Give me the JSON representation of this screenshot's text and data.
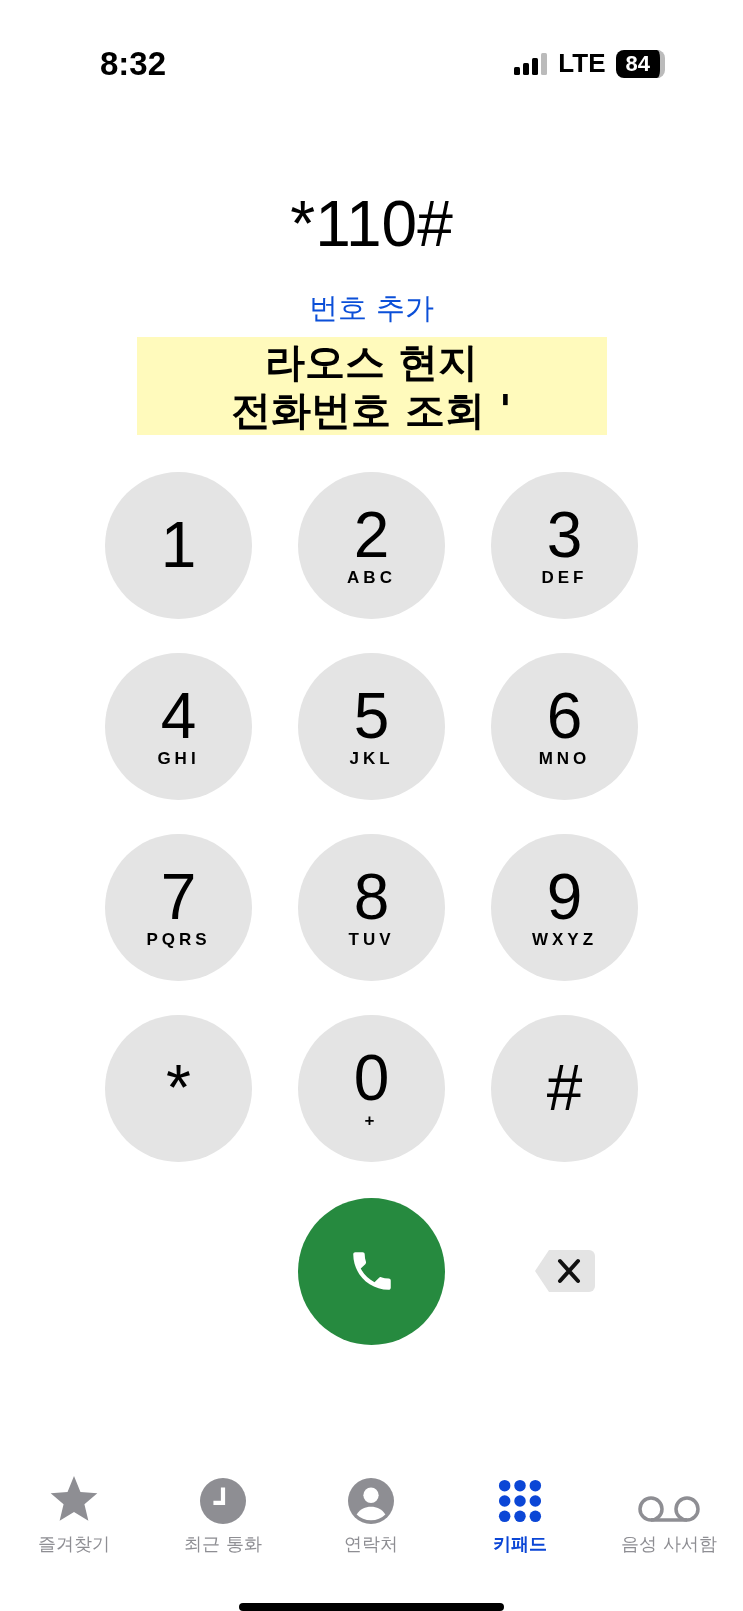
{
  "status_bar": {
    "time": "8:32",
    "network": "LTE",
    "battery": "84"
  },
  "display": {
    "number": "*110#",
    "add_number": "번호 추가"
  },
  "caption": {
    "lines": [
      "라오스 현지",
      "전화번호 조회 '"
    ]
  },
  "keys": [
    {
      "digit": "1"
    },
    {
      "digit": "2",
      "letters": "ABC"
    },
    {
      "digit": "3",
      "letters": "DEF"
    },
    {
      "digit": "4",
      "letters": "GHI"
    },
    {
      "digit": "5",
      "letters": "JKL"
    },
    {
      "digit": "6",
      "letters": "MNO"
    },
    {
      "digit": "7",
      "letters": "PQRS"
    },
    {
      "digit": "8",
      "letters": "TUV"
    },
    {
      "digit": "9",
      "letters": "WXYZ"
    },
    {
      "digit": "*"
    },
    {
      "digit": "0",
      "letters": "+"
    },
    {
      "digit": "#"
    }
  ],
  "tabs": [
    {
      "kind": "star",
      "label": "즐겨찾기",
      "selected": false
    },
    {
      "kind": "clock",
      "label": "최근 통화",
      "selected": false
    },
    {
      "kind": "person",
      "label": "연락처",
      "selected": false
    },
    {
      "kind": "keypad",
      "label": "키패드",
      "selected": true
    },
    {
      "kind": "voicemail",
      "label": "음성 사서함",
      "selected": false
    }
  ]
}
